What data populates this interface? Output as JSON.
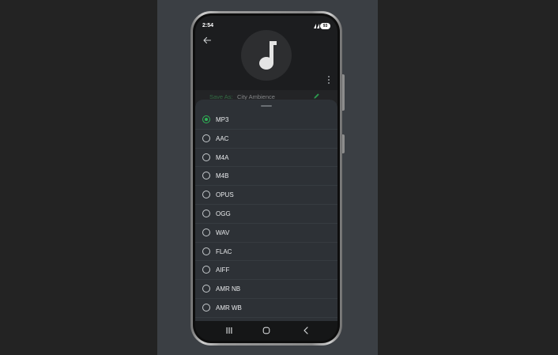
{
  "status_bar": {
    "time": "2:54",
    "battery": "93"
  },
  "header": {
    "back_icon": "arrow-left-icon",
    "album_icon": "music-note-icon",
    "more_icon": "more-vertical-icon"
  },
  "save_as": {
    "label": "Save As:",
    "filename": "City Ambience",
    "edit_icon": "pencil-icon"
  },
  "format_sheet": {
    "selected": "MP3",
    "options": [
      {
        "label": "MP3",
        "selected": true
      },
      {
        "label": "AAC",
        "selected": false
      },
      {
        "label": "M4A",
        "selected": false
      },
      {
        "label": "M4B",
        "selected": false
      },
      {
        "label": "OPUS",
        "selected": false
      },
      {
        "label": "OGG",
        "selected": false
      },
      {
        "label": "WAV",
        "selected": false
      },
      {
        "label": "FLAC",
        "selected": false
      },
      {
        "label": "AIFF",
        "selected": false
      },
      {
        "label": "AMR NB",
        "selected": false
      },
      {
        "label": "AMR WB",
        "selected": false
      }
    ]
  },
  "nav_bar": {
    "recent": "recent-apps-icon",
    "home": "home-icon",
    "back": "back-chevron-icon"
  },
  "colors": {
    "accent": "#2fb657",
    "sheet_bg": "#2d3136",
    "screen_bg": "#1c1d1f"
  }
}
